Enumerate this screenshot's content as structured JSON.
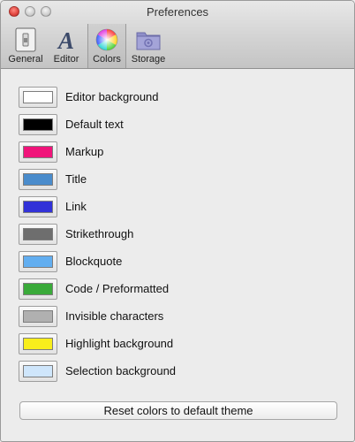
{
  "window": {
    "title": "Preferences"
  },
  "toolbar": {
    "items": [
      {
        "label": "General",
        "icon": "switch-icon"
      },
      {
        "label": "Editor",
        "icon": "font-icon"
      },
      {
        "label": "Colors",
        "icon": "color-wheel-icon",
        "selected": true
      },
      {
        "label": "Storage",
        "icon": "folder-icon"
      }
    ]
  },
  "colors": [
    {
      "label": "Editor background",
      "color": "#ffffff"
    },
    {
      "label": "Default text",
      "color": "#000000"
    },
    {
      "label": "Markup",
      "color": "#f0147a"
    },
    {
      "label": "Title",
      "color": "#4a8ccc"
    },
    {
      "label": "Link",
      "color": "#3232d8"
    },
    {
      "label": "Strikethrough",
      "color": "#6e6e6e"
    },
    {
      "label": "Blockquote",
      "color": "#62aef0"
    },
    {
      "label": "Code / Preformatted",
      "color": "#3aaa3a"
    },
    {
      "label": "Invisible characters",
      "color": "#b0b0b0"
    },
    {
      "label": "Highlight background",
      "color": "#f8ee1c"
    },
    {
      "label": "Selection background",
      "color": "#cfe6fb"
    }
  ],
  "reset_label": "Reset colors to default theme"
}
